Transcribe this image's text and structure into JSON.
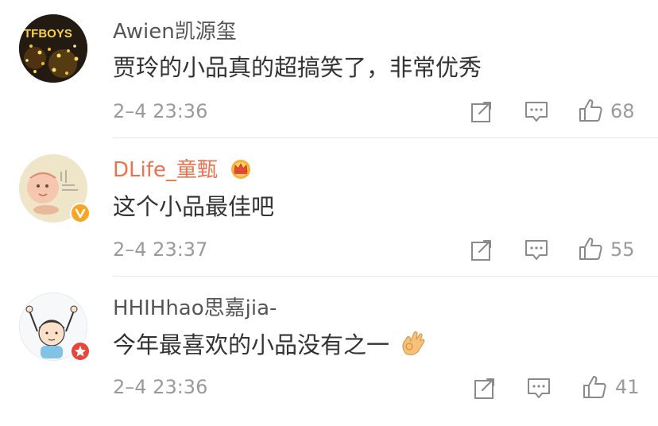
{
  "comments": [
    {
      "username": "Awien凯源玺",
      "username_color": "#555555",
      "avatar_text": "TFBOYS",
      "text": "贾玲的小品真的超搞笑了，非常优秀",
      "time": "2–4 23:36",
      "likes": "68",
      "icons": [
        "share-icon",
        "comment-icon",
        "like-icon"
      ]
    },
    {
      "username": "DLife_童甄",
      "username_color": "#eb7350",
      "vip_icon": "crown-icon",
      "verified_badge": "verified-v-badge",
      "text": "这个小品最佳吧",
      "time": "2–4 23:37",
      "likes": "55",
      "icons": [
        "share-icon",
        "comment-icon",
        "like-icon"
      ]
    },
    {
      "username": "HHIHhao思嘉jia-",
      "username_color": "#555555",
      "verified_badge": "star-badge",
      "text": "今年最喜欢的小品没有之一",
      "emoji": "ok-hand-emoji",
      "time": "2–4 23:36",
      "likes": "41",
      "icons": [
        "share-icon",
        "comment-icon",
        "like-icon"
      ]
    }
  ]
}
